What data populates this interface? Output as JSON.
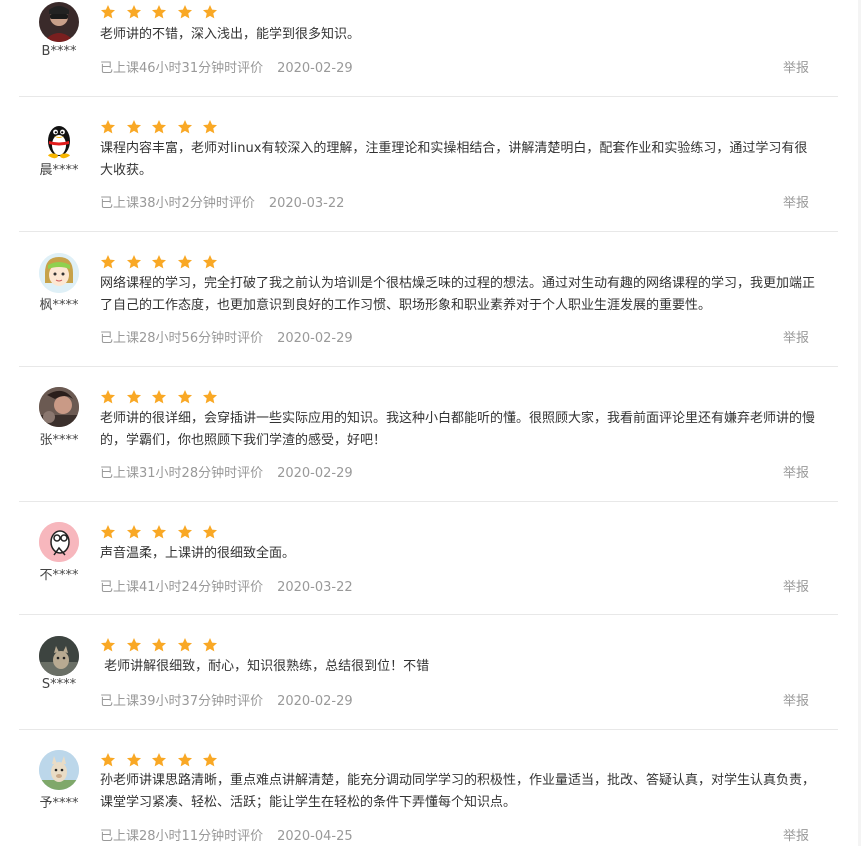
{
  "colors": {
    "star": "#f9a825",
    "text": "#333333",
    "meta": "#999999",
    "divider": "#e8e8e8"
  },
  "reviews": [
    {
      "user": "B****",
      "avatar_icon": "dark-portrait-avatar-icon",
      "stars": 5,
      "content": "老师讲的不错，深入浅出，能学到很多知识。",
      "time_label": "已上课46小时31分钟时评价",
      "date": "2020-02-29",
      "report": "举报"
    },
    {
      "user": "晨****",
      "avatar_icon": "qq-penguin-avatar-icon",
      "stars": 5,
      "content": "课程内容丰富，老师对linux有较深入的理解，注重理论和实操相结合，讲解清楚明白，配套作业和实验练习，通过学习有很大收获。",
      "time_label": "已上课38小时2分钟时评价",
      "date": "2020-03-22",
      "report": "举报"
    },
    {
      "user": "枫****",
      "avatar_icon": "cartoon-girl-avatar-icon",
      "stars": 5,
      "content": "网络课程的学习，完全打破了我之前认为培训是个很枯燥乏味的过程的想法。通过对生动有趣的网络课程的学习，我更加端正了自己的工作态度，也更加意识到良好的工作习惯、职场形象和职业素养对于个人职业生涯发展的重要性。",
      "time_label": "已上课28小时56分钟时评价",
      "date": "2020-02-29",
      "report": "举报"
    },
    {
      "user": "张****",
      "avatar_icon": "photo-avatar-icon",
      "stars": 5,
      "content": "老师讲的很详细，会穿插讲一些实际应用的知识。我这种小白都能听的懂。很照顾大家，我看前面评论里还有嫌弃老师讲的慢的，学霸们，你也照顾下我们学渣的感受，好吧！",
      "time_label": "已上课31小时28分钟时评价",
      "date": "2020-02-29",
      "report": "举报"
    },
    {
      "user": "不****",
      "avatar_icon": "pink-cartoon-avatar-icon",
      "stars": 5,
      "content": "声音温柔，上课讲的很细致全面。",
      "time_label": "已上课41小时24分钟时评价",
      "date": "2020-03-22",
      "report": "举报"
    },
    {
      "user": "S****",
      "avatar_icon": "cat-photo-avatar-icon",
      "stars": 5,
      "content": " 老师讲解很细致，耐心，知识很熟练，总结很到位！不错",
      "time_label": "已上课39小时37分钟时评价",
      "date": "2020-02-29",
      "report": "举报"
    },
    {
      "user": "予****",
      "avatar_icon": "alpaca-avatar-icon",
      "stars": 5,
      "content": "孙老师讲课思路清晰，重点难点讲解清楚，能充分调动同学学习的积极性，作业量适当，批改、答疑认真，对学生认真负责，课堂学习紧凑、轻松、活跃；能让学生在轻松的条件下弄懂每个知识点。",
      "time_label": "已上课28小时11分钟时评价",
      "date": "2020-04-25",
      "report": "举报"
    }
  ]
}
